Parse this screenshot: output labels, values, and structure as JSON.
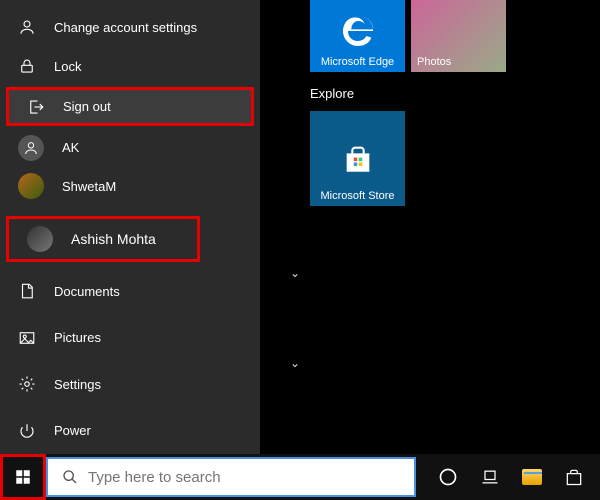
{
  "userMenu": {
    "changeAccount": "Change account settings",
    "lock": "Lock",
    "signOut": "Sign out",
    "otherUsers": [
      "AK",
      "ShwetaM"
    ],
    "currentUser": "Ashish Mohta"
  },
  "startLinks": {
    "documents": "Documents",
    "pictures": "Pictures",
    "settings": "Settings",
    "power": "Power"
  },
  "tiles": {
    "edge": "Microsoft Edge",
    "photos": "Photos",
    "explore": "Explore",
    "store": "Microsoft Store"
  },
  "taskbar": {
    "searchPlaceholder": "Type here to search"
  }
}
